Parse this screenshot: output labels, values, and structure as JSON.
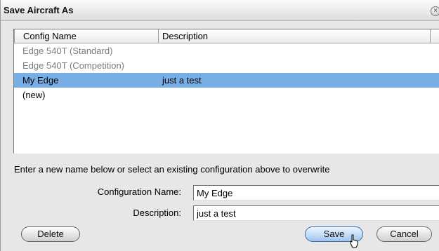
{
  "window": {
    "title": "Save Aircraft As",
    "close_glyph": "×"
  },
  "table": {
    "columns": [
      "Config Name",
      "Description"
    ],
    "rows": [
      {
        "name": "Edge 540T (Standard)",
        "description": ""
      },
      {
        "name": "Edge 540T (Competition)",
        "description": ""
      },
      {
        "name": "My Edge",
        "description": "just a test"
      },
      {
        "name": "(new)",
        "description": ""
      }
    ],
    "selected_index": 2,
    "selection_color": "#78aee6"
  },
  "hint": "Enter a new name below or select an existing configuration above to overwrite",
  "form": {
    "config_label": "Configuration Name:",
    "config_value": "My Edge",
    "description_label": "Description:",
    "description_value": "just a test"
  },
  "buttons": {
    "delete": "Delete",
    "save": "Save",
    "cancel": "Cancel"
  }
}
